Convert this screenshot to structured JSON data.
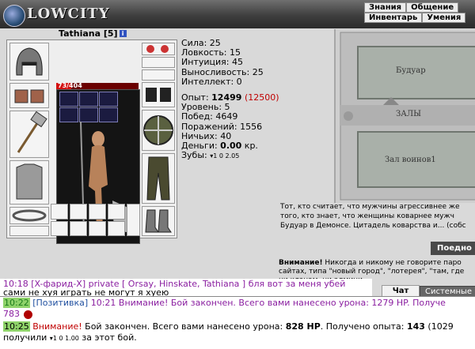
{
  "header": {
    "logo": "LOWCITY",
    "nav_top": [
      "Знания",
      "Общение"
    ],
    "nav_bottom": [
      "Инвентарь",
      "Умения"
    ]
  },
  "character": {
    "name": "Tathiana [5]",
    "info_icon": "i",
    "hp_text": "73/404",
    "hp_current": 73,
    "hp_max": 404
  },
  "stats": {
    "strength": "Сила: 25",
    "agility": "Ловкость: 15",
    "intuition": "Интуиция: 45",
    "endurance": "Выносливость: 25",
    "intellect": "Интеллект: 0",
    "exp_label": "Опыт: ",
    "exp_value": "12499",
    "exp_next": "(12500)",
    "level": "Уровень: 5",
    "wins": "Побед: 4649",
    "losses": "Поражений: 1556",
    "draws": "Ничьих: 40",
    "money_label": "Деньги: ",
    "money_value": "0.00",
    "money_unit": " кр.",
    "teeth_label": "Зубы: ",
    "teeth_values": "1 0 2.05"
  },
  "map": {
    "label_boudoir": "Будуар",
    "label_halls": "ЗАЛЫ",
    "label_warriors": "Зал воинов1"
  },
  "quote": {
    "text": "Тот, кто считает, что мужчины агрессивнее же того, кто знает, что женщины коварнее мужч Будуар в Демонсе. Цитадель коварства и... (собс"
  },
  "buttons": {
    "goto": "Поедно"
  },
  "warning": {
    "bold": "Внимание!",
    "text": " Никогда и никому не говорите паро сайтах, типа \"новый город\", \"лотерея\", \"там, где ни кланам, ни админи"
  },
  "tabs": {
    "chat": "Чат",
    "system": "Системные"
  },
  "chat": {
    "line0": "10:18 [X-фарид-X] private [ Orsay, Hinskate, Tathiana ] бля вот за меня убей",
    "line1": "сами не хуя играть не могут я хуею",
    "line2_ts": "10:22",
    "line2_channel": "[Позитивка]",
    "line2_time": " 10:21 ",
    "line2_text": "Внимание! Бой закончен. Всего вами нанесено урона: 1279 HP. Получе",
    "line3": "783",
    "line4_ts": "10:25",
    "line4_warn": "Внимание!",
    "line4_text1": " Бой закончен. Всего вами нанесено урона: ",
    "line4_hp": "828 HP",
    "line4_text2": ". Получено опыта: ",
    "line4_exp": "143",
    "line4_tail": " (1029",
    "line5_pre": "получили ",
    "line5_vals": "1 0 1.00",
    "line5_post": " за этот бой."
  },
  "colors": {
    "hp_fill": "#d41010",
    "exp_next": "#c00000",
    "timestamp_bg": "#8fd36a"
  }
}
